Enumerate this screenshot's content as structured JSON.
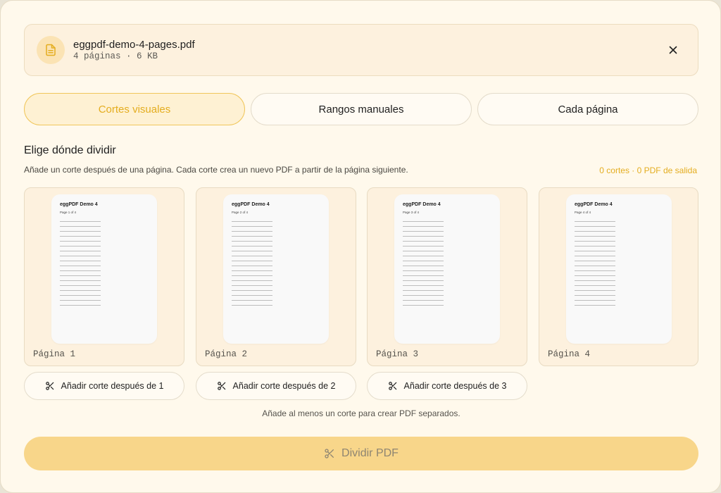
{
  "file": {
    "name": "eggpdf-demo-4-pages.pdf",
    "meta": "4 páginas · 6 KB",
    "icon": "file-text-icon",
    "accent": "#e4ad1f"
  },
  "tabs": [
    {
      "label": "Cortes visuales",
      "active": true
    },
    {
      "label": "Rangos manuales",
      "active": false
    },
    {
      "label": "Cada página",
      "active": false
    }
  ],
  "section": {
    "title": "Elige dónde dividir",
    "description": "Añade un corte después de una página. Cada corte crea un nuevo PDF a partir de la página siguiente.",
    "summary": "0 cortes · 0 PDF de salida"
  },
  "pages": [
    {
      "thumb_title": "eggPDF Demo 4",
      "thumb_sub": "Page 1 of 4",
      "label": "Página 1"
    },
    {
      "thumb_title": "eggPDF Demo 4",
      "thumb_sub": "Page 2 of 4",
      "label": "Página 2"
    },
    {
      "thumb_title": "eggPDF Demo 4",
      "thumb_sub": "Page 3 of 4",
      "label": "Página 3"
    },
    {
      "thumb_title": "eggPDF Demo 4",
      "thumb_sub": "Page 4 of 4",
      "label": "Página 4"
    }
  ],
  "cut_buttons": [
    {
      "label": "Añadir corte después de 1",
      "icon": "scissors-icon"
    },
    {
      "label": "Añadir corte después de 2",
      "icon": "scissors-icon"
    },
    {
      "label": "Añadir corte después de 3",
      "icon": "scissors-icon"
    }
  ],
  "hint": "Añade al menos un corte para crear PDF separados.",
  "split_button": {
    "label": "Dividir PDF",
    "icon": "scissors-icon",
    "enabled": false
  }
}
